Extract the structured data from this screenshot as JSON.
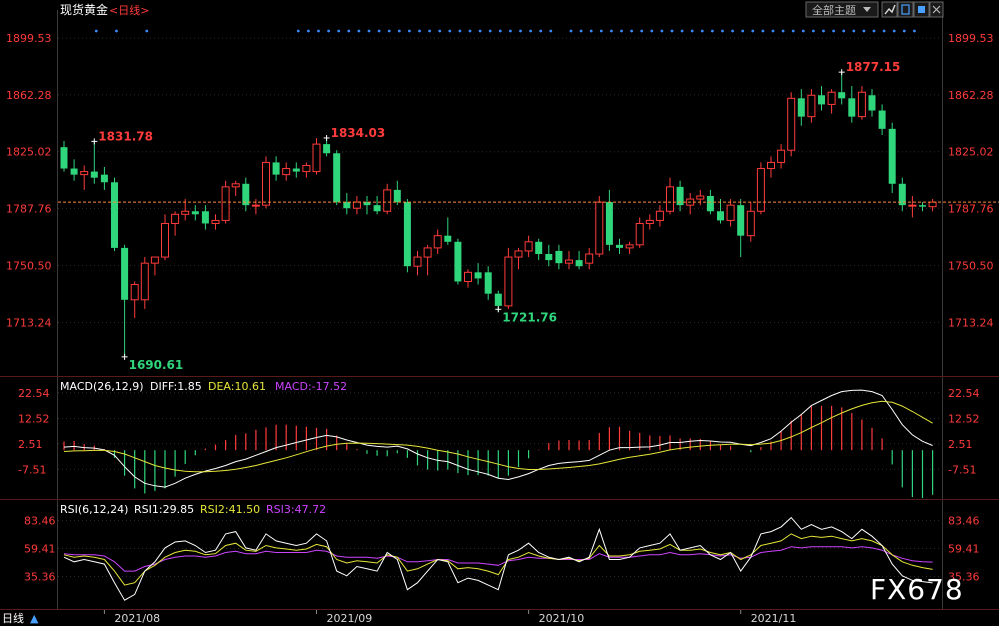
{
  "header": {
    "instrument": "现货黄金",
    "period_label": "<日线>",
    "theme_button": "全部主题",
    "dropdown_icon": "triangle-down-icon",
    "icons": [
      "chart-up-icon",
      "page-icon",
      "square-icon"
    ]
  },
  "watermark": "FX678",
  "bottom_bar": {
    "period": "日线",
    "arrow": "▲"
  },
  "colors": {
    "up": "#ff3b3b",
    "down": "#2fd67c",
    "diff": "#ffffff",
    "dea": "#e6e63a",
    "macd": "#cc44ff",
    "rsi1": "#ffffff",
    "rsi2": "#e6e63a",
    "rsi3": "#cc44ff",
    "grid": "#2a2a2a",
    "last_price": "#ff8a3a",
    "signal_dot": "#3a8aff"
  },
  "chart_data": {
    "type": "candlestick",
    "price_ticks": [
      "1899.53",
      "1862.28",
      "1825.02",
      "1787.76",
      "1750.50",
      "1713.24"
    ],
    "price_tick_values": [
      1899.53,
      1862.28,
      1825.02,
      1787.76,
      1750.5,
      1713.24
    ],
    "ylim": [
      1682,
      1910
    ],
    "last_price": 1792,
    "date_labels": [
      {
        "label": "2021/08",
        "index": 4
      },
      {
        "label": "2021/09",
        "index": 25
      },
      {
        "label": "2021/10",
        "index": 46
      },
      {
        "label": "2021/11",
        "index": 67
      }
    ],
    "annotations": [
      {
        "label": "1831.78",
        "value": 1831.78,
        "index": 3,
        "color": "up"
      },
      {
        "label": "1690.61",
        "value": 1690.61,
        "index": 6,
        "color": "down"
      },
      {
        "label": "1834.03",
        "value": 1834.03,
        "index": 26,
        "color": "up"
      },
      {
        "label": "1721.76",
        "value": 1721.76,
        "index": 43,
        "color": "down"
      },
      {
        "label": "1877.15",
        "value": 1877.15,
        "index": 77,
        "color": "up"
      }
    ],
    "candles": [
      {
        "o": 1828,
        "h": 1832,
        "l": 1812,
        "c": 1814
      },
      {
        "o": 1814,
        "h": 1820,
        "l": 1806,
        "c": 1810
      },
      {
        "o": 1810,
        "h": 1816,
        "l": 1800,
        "c": 1812
      },
      {
        "o": 1812,
        "h": 1832,
        "l": 1804,
        "c": 1808
      },
      {
        "o": 1810,
        "h": 1815,
        "l": 1800,
        "c": 1805
      },
      {
        "o": 1805,
        "h": 1808,
        "l": 1760,
        "c": 1762
      },
      {
        "o": 1762,
        "h": 1764,
        "l": 1691,
        "c": 1728
      },
      {
        "o": 1728,
        "h": 1740,
        "l": 1716,
        "c": 1738
      },
      {
        "o": 1728,
        "h": 1756,
        "l": 1722,
        "c": 1752
      },
      {
        "o": 1752,
        "h": 1756,
        "l": 1744,
        "c": 1756
      },
      {
        "o": 1756,
        "h": 1784,
        "l": 1754,
        "c": 1778
      },
      {
        "o": 1778,
        "h": 1786,
        "l": 1770,
        "c": 1784
      },
      {
        "o": 1784,
        "h": 1794,
        "l": 1780,
        "c": 1786
      },
      {
        "o": 1786,
        "h": 1790,
        "l": 1780,
        "c": 1784
      },
      {
        "o": 1786,
        "h": 1790,
        "l": 1774,
        "c": 1778
      },
      {
        "o": 1778,
        "h": 1784,
        "l": 1774,
        "c": 1780
      },
      {
        "o": 1780,
        "h": 1806,
        "l": 1778,
        "c": 1802
      },
      {
        "o": 1802,
        "h": 1806,
        "l": 1796,
        "c": 1804
      },
      {
        "o": 1804,
        "h": 1808,
        "l": 1786,
        "c": 1790
      },
      {
        "o": 1790,
        "h": 1794,
        "l": 1784,
        "c": 1790
      },
      {
        "o": 1790,
        "h": 1822,
        "l": 1788,
        "c": 1818
      },
      {
        "o": 1818,
        "h": 1822,
        "l": 1806,
        "c": 1810
      },
      {
        "o": 1810,
        "h": 1818,
        "l": 1806,
        "c": 1814
      },
      {
        "o": 1814,
        "h": 1818,
        "l": 1808,
        "c": 1812
      },
      {
        "o": 1812,
        "h": 1818,
        "l": 1808,
        "c": 1816
      },
      {
        "o": 1812,
        "h": 1834,
        "l": 1810,
        "c": 1830
      },
      {
        "o": 1830,
        "h": 1834,
        "l": 1822,
        "c": 1824
      },
      {
        "o": 1824,
        "h": 1826,
        "l": 1790,
        "c": 1792
      },
      {
        "o": 1792,
        "h": 1798,
        "l": 1784,
        "c": 1788
      },
      {
        "o": 1788,
        "h": 1796,
        "l": 1784,
        "c": 1792
      },
      {
        "o": 1792,
        "h": 1796,
        "l": 1784,
        "c": 1790
      },
      {
        "o": 1790,
        "h": 1796,
        "l": 1784,
        "c": 1786
      },
      {
        "o": 1786,
        "h": 1804,
        "l": 1784,
        "c": 1800
      },
      {
        "o": 1800,
        "h": 1806,
        "l": 1790,
        "c": 1792
      },
      {
        "o": 1792,
        "h": 1794,
        "l": 1746,
        "c": 1750
      },
      {
        "o": 1750,
        "h": 1760,
        "l": 1744,
        "c": 1756
      },
      {
        "o": 1756,
        "h": 1764,
        "l": 1744,
        "c": 1762
      },
      {
        "o": 1762,
        "h": 1774,
        "l": 1758,
        "c": 1770
      },
      {
        "o": 1770,
        "h": 1782,
        "l": 1764,
        "c": 1766
      },
      {
        "o": 1766,
        "h": 1768,
        "l": 1738,
        "c": 1740
      },
      {
        "o": 1740,
        "h": 1748,
        "l": 1736,
        "c": 1746
      },
      {
        "o": 1746,
        "h": 1752,
        "l": 1738,
        "c": 1742
      },
      {
        "o": 1746,
        "h": 1750,
        "l": 1728,
        "c": 1732
      },
      {
        "o": 1732,
        "h": 1734,
        "l": 1720,
        "c": 1724
      },
      {
        "o": 1724,
        "h": 1762,
        "l": 1722,
        "c": 1756
      },
      {
        "o": 1756,
        "h": 1762,
        "l": 1748,
        "c": 1760
      },
      {
        "o": 1760,
        "h": 1770,
        "l": 1756,
        "c": 1766
      },
      {
        "o": 1766,
        "h": 1768,
        "l": 1754,
        "c": 1758
      },
      {
        "o": 1758,
        "h": 1764,
        "l": 1750,
        "c": 1754
      },
      {
        "o": 1760,
        "h": 1764,
        "l": 1748,
        "c": 1752
      },
      {
        "o": 1752,
        "h": 1760,
        "l": 1748,
        "c": 1754
      },
      {
        "o": 1754,
        "h": 1760,
        "l": 1748,
        "c": 1750
      },
      {
        "o": 1752,
        "h": 1762,
        "l": 1748,
        "c": 1758
      },
      {
        "o": 1758,
        "h": 1796,
        "l": 1756,
        "c": 1792
      },
      {
        "o": 1792,
        "h": 1800,
        "l": 1760,
        "c": 1764
      },
      {
        "o": 1764,
        "h": 1768,
        "l": 1758,
        "c": 1762
      },
      {
        "o": 1762,
        "h": 1766,
        "l": 1758,
        "c": 1764
      },
      {
        "o": 1764,
        "h": 1782,
        "l": 1762,
        "c": 1778
      },
      {
        "o": 1778,
        "h": 1784,
        "l": 1774,
        "c": 1780
      },
      {
        "o": 1780,
        "h": 1790,
        "l": 1776,
        "c": 1786
      },
      {
        "o": 1786,
        "h": 1808,
        "l": 1784,
        "c": 1802
      },
      {
        "o": 1802,
        "h": 1806,
        "l": 1786,
        "c": 1790
      },
      {
        "o": 1790,
        "h": 1798,
        "l": 1784,
        "c": 1794
      },
      {
        "o": 1794,
        "h": 1800,
        "l": 1790,
        "c": 1796
      },
      {
        "o": 1796,
        "h": 1800,
        "l": 1784,
        "c": 1786
      },
      {
        "o": 1786,
        "h": 1794,
        "l": 1778,
        "c": 1780
      },
      {
        "o": 1780,
        "h": 1794,
        "l": 1776,
        "c": 1790
      },
      {
        "o": 1790,
        "h": 1794,
        "l": 1756,
        "c": 1770
      },
      {
        "o": 1770,
        "h": 1792,
        "l": 1766,
        "c": 1786
      },
      {
        "o": 1786,
        "h": 1818,
        "l": 1784,
        "c": 1814
      },
      {
        "o": 1814,
        "h": 1822,
        "l": 1808,
        "c": 1818
      },
      {
        "o": 1818,
        "h": 1830,
        "l": 1814,
        "c": 1826
      },
      {
        "o": 1826,
        "h": 1864,
        "l": 1822,
        "c": 1860
      },
      {
        "o": 1860,
        "h": 1866,
        "l": 1842,
        "c": 1848
      },
      {
        "o": 1848,
        "h": 1866,
        "l": 1844,
        "c": 1862
      },
      {
        "o": 1862,
        "h": 1868,
        "l": 1852,
        "c": 1856
      },
      {
        "o": 1856,
        "h": 1866,
        "l": 1850,
        "c": 1864
      },
      {
        "o": 1864,
        "h": 1877,
        "l": 1856,
        "c": 1860
      },
      {
        "o": 1860,
        "h": 1868,
        "l": 1844,
        "c": 1848
      },
      {
        "o": 1848,
        "h": 1868,
        "l": 1846,
        "c": 1864
      },
      {
        "o": 1862,
        "h": 1866,
        "l": 1848,
        "c": 1852
      },
      {
        "o": 1852,
        "h": 1856,
        "l": 1836,
        "c": 1840
      },
      {
        "o": 1840,
        "h": 1844,
        "l": 1798,
        "c": 1804
      },
      {
        "o": 1804,
        "h": 1808,
        "l": 1786,
        "c": 1790
      },
      {
        "o": 1790,
        "h": 1796,
        "l": 1782,
        "c": 1790
      },
      {
        "o": 1790,
        "h": 1792,
        "l": 1786,
        "c": 1789
      },
      {
        "o": 1789,
        "h": 1794,
        "l": 1786,
        "c": 1792
      }
    ],
    "macd": {
      "label": "MACD(26,12,9)",
      "diff_label": "DIFF:1.85",
      "dea_label": "DEA:10.61",
      "macd_label": "MACD:-17.52",
      "ticks": [
        "22.54",
        "12.52",
        "2.51",
        "-7.51"
      ],
      "tick_values": [
        22.54,
        12.52,
        2.51,
        -7.51
      ],
      "ylim": [
        -18,
        26
      ],
      "diff": [
        1.2,
        1.5,
        1.0,
        0.8,
        0.1,
        -2.0,
        -6.5,
        -10.5,
        -13,
        -14,
        -14.5,
        -13,
        -11,
        -9.5,
        -8.2,
        -7.2,
        -6,
        -4.5,
        -3.5,
        -2,
        -0.5,
        1,
        2,
        3,
        4,
        5,
        5.8,
        5.2,
        4,
        3,
        2,
        1.5,
        1.2,
        1.6,
        0.5,
        -1.5,
        -3,
        -4,
        -4.5,
        -6,
        -7.5,
        -8.5,
        -9.5,
        -11,
        -11.5,
        -10.5,
        -9.2,
        -7.5,
        -6,
        -5.2,
        -4.8,
        -4.5,
        -4,
        -2,
        0,
        1,
        1,
        1.2,
        1.3,
        2,
        3,
        3,
        3.5,
        3.8,
        3.6,
        3.2,
        3.1,
        2.3,
        1.8,
        3,
        4.5,
        7.5,
        11,
        14,
        17.5,
        19.5,
        21.5,
        23,
        23.5,
        23.6,
        23,
        21.5,
        16,
        10,
        6,
        3.5,
        1.85
      ],
      "dea": [
        -0.5,
        -0.3,
        -0.2,
        -0.1,
        -0.1,
        -0.5,
        -1.5,
        -3,
        -4.5,
        -6,
        -7,
        -7.8,
        -8.3,
        -8.5,
        -8.5,
        -8.3,
        -8,
        -7.5,
        -6.8,
        -6,
        -5,
        -4,
        -3,
        -1.8,
        -0.6,
        0.6,
        1.6,
        2.3,
        2.7,
        2.8,
        2.7,
        2.6,
        2.4,
        2.2,
        2,
        1.5,
        0.8,
        0,
        -0.7,
        -1.5,
        -2.6,
        -3.6,
        -4.5,
        -5.5,
        -6.5,
        -7.2,
        -7.6,
        -7.6,
        -7.4,
        -7.1,
        -6.8,
        -6.4,
        -6,
        -5.4,
        -4.5,
        -3.6,
        -2.8,
        -2.2,
        -1.6,
        -0.8,
        0.1,
        0.7,
        1.2,
        1.6,
        1.9,
        2.1,
        2.3,
        2.3,
        2.2,
        2.4,
        2.8,
        3.8,
        5.2,
        6.9,
        8.9,
        10.8,
        12.8,
        14.6,
        16.2,
        17.6,
        18.6,
        19.2,
        18.8,
        17.3,
        15.2,
        12.9,
        10.61
      ]
    },
    "rsi": {
      "label": "RSI(6,12,24)",
      "rsi1_label": "RSI1:29.85",
      "rsi2_label": "RSI2:41.50",
      "rsi3_label": "RSI3:47.72",
      "ticks": [
        "83.46",
        "59.41",
        "35.36"
      ],
      "tick_values": [
        83.46,
        59.41,
        35.36
      ],
      "ylim": [
        10,
        96
      ],
      "rsi1": [
        52,
        48,
        50,
        48,
        46,
        30,
        15,
        20,
        40,
        48,
        60,
        65,
        66,
        62,
        56,
        58,
        72,
        74,
        60,
        58,
        72,
        66,
        64,
        62,
        64,
        72,
        66,
        40,
        36,
        44,
        42,
        40,
        56,
        50,
        24,
        30,
        40,
        50,
        48,
        30,
        34,
        32,
        28,
        24,
        54,
        58,
        64,
        56,
        52,
        50,
        52,
        48,
        52,
        76,
        50,
        50,
        52,
        60,
        62,
        64,
        72,
        58,
        60,
        62,
        54,
        50,
        56,
        40,
        52,
        72,
        74,
        78,
        86,
        76,
        80,
        76,
        78,
        74,
        68,
        76,
        70,
        62,
        46,
        36,
        32,
        31,
        29.85
      ],
      "rsi2": [
        54,
        52,
        53,
        52,
        50,
        40,
        28,
        30,
        40,
        45,
        52,
        56,
        58,
        57,
        54,
        55,
        62,
        64,
        58,
        57,
        62,
        60,
        59,
        58,
        59,
        63,
        61,
        50,
        47,
        49,
        48,
        47,
        54,
        52,
        40,
        42,
        46,
        50,
        49,
        42,
        43,
        42,
        40,
        37,
        50,
        52,
        56,
        53,
        51,
        50,
        51,
        49,
        51,
        62,
        53,
        53,
        54,
        57,
        58,
        59,
        63,
        58,
        58,
        59,
        56,
        54,
        56,
        50,
        54,
        62,
        64,
        66,
        72,
        68,
        70,
        69,
        70,
        68,
        66,
        68,
        66,
        62,
        54,
        48,
        45,
        43,
        41.5
      ],
      "rsi3": [
        55,
        54,
        54,
        54,
        53,
        48,
        40,
        40,
        44,
        46,
        50,
        52,
        53,
        53,
        52,
        53,
        56,
        57,
        55,
        55,
        57,
        56,
        56,
        56,
        56,
        58,
        57,
        53,
        52,
        52,
        52,
        51,
        53,
        52,
        48,
        48,
        49,
        50,
        50,
        47,
        47,
        47,
        46,
        45,
        49,
        50,
        52,
        51,
        51,
        50,
        50,
        50,
        50,
        55,
        52,
        52,
        52,
        53,
        54,
        54,
        56,
        54,
        54,
        55,
        54,
        53,
        54,
        51,
        52,
        56,
        57,
        58,
        61,
        60,
        61,
        61,
        61,
        61,
        60,
        61,
        60,
        58,
        54,
        51,
        49,
        48,
        47.72
      ]
    }
  }
}
